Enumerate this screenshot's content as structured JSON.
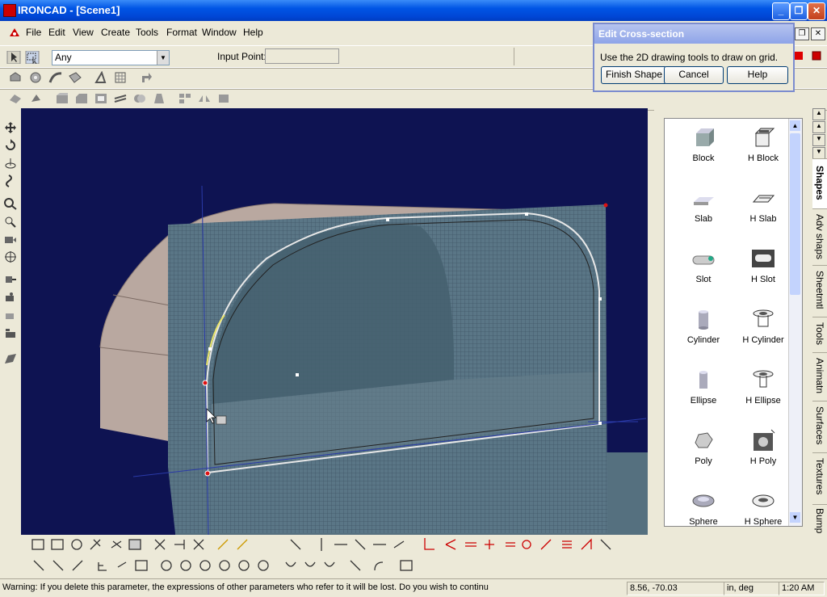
{
  "window": {
    "title": "IRONCAD - [Scene1]"
  },
  "menu": [
    "File",
    "Edit",
    "View",
    "Create",
    "Tools",
    "Format",
    "Window",
    "Help"
  ],
  "selection_bar": {
    "filter_value": "Any",
    "input_point_label": "Input Point:",
    "input_point_value": ""
  },
  "dialog": {
    "title": "Edit Cross-section",
    "message": "Use the 2D drawing tools to draw on grid.",
    "buttons": [
      "Finish Shape",
      "Cancel",
      "Help"
    ]
  },
  "catalog": {
    "items": [
      {
        "label": "Block",
        "icon": "block-icon"
      },
      {
        "label": "H Block",
        "icon": "hollow-block-icon"
      },
      {
        "label": "Slab",
        "icon": "slab-icon"
      },
      {
        "label": "H Slab",
        "icon": "hollow-slab-icon"
      },
      {
        "label": "Slot",
        "icon": "slot-icon"
      },
      {
        "label": "H Slot",
        "icon": "hollow-slot-icon"
      },
      {
        "label": "Cylinder",
        "icon": "cylinder-icon"
      },
      {
        "label": "H Cylinder",
        "icon": "hollow-cylinder-icon"
      },
      {
        "label": "Ellipse",
        "icon": "ellipse-icon"
      },
      {
        "label": "H Ellipse",
        "icon": "hollow-ellipse-icon"
      },
      {
        "label": "Poly",
        "icon": "poly-icon"
      },
      {
        "label": "H Poly",
        "icon": "hollow-poly-icon"
      },
      {
        "label": "Sphere",
        "icon": "sphere-icon"
      },
      {
        "label": "H Sphere",
        "icon": "hollow-sphere-icon"
      }
    ],
    "tabs": [
      "Shapes",
      "Adv shaps",
      "Sheetmtl",
      "Tools",
      "Animatn",
      "Surfaces",
      "Textures",
      "Bump"
    ],
    "active_tab": "Shapes"
  },
  "status": {
    "message": "Warning: If you delete this parameter, the expressions of other parameters who refer to it will be lost. Do you wish to continu",
    "coordinates": "8.56, -70.03",
    "units": "in, deg",
    "time": "1:20 AM"
  },
  "colors": {
    "viewport_bg": "#0e1352",
    "titlebar": "#0055e5",
    "grid": "#5d7689",
    "part": "#bfaea6"
  }
}
